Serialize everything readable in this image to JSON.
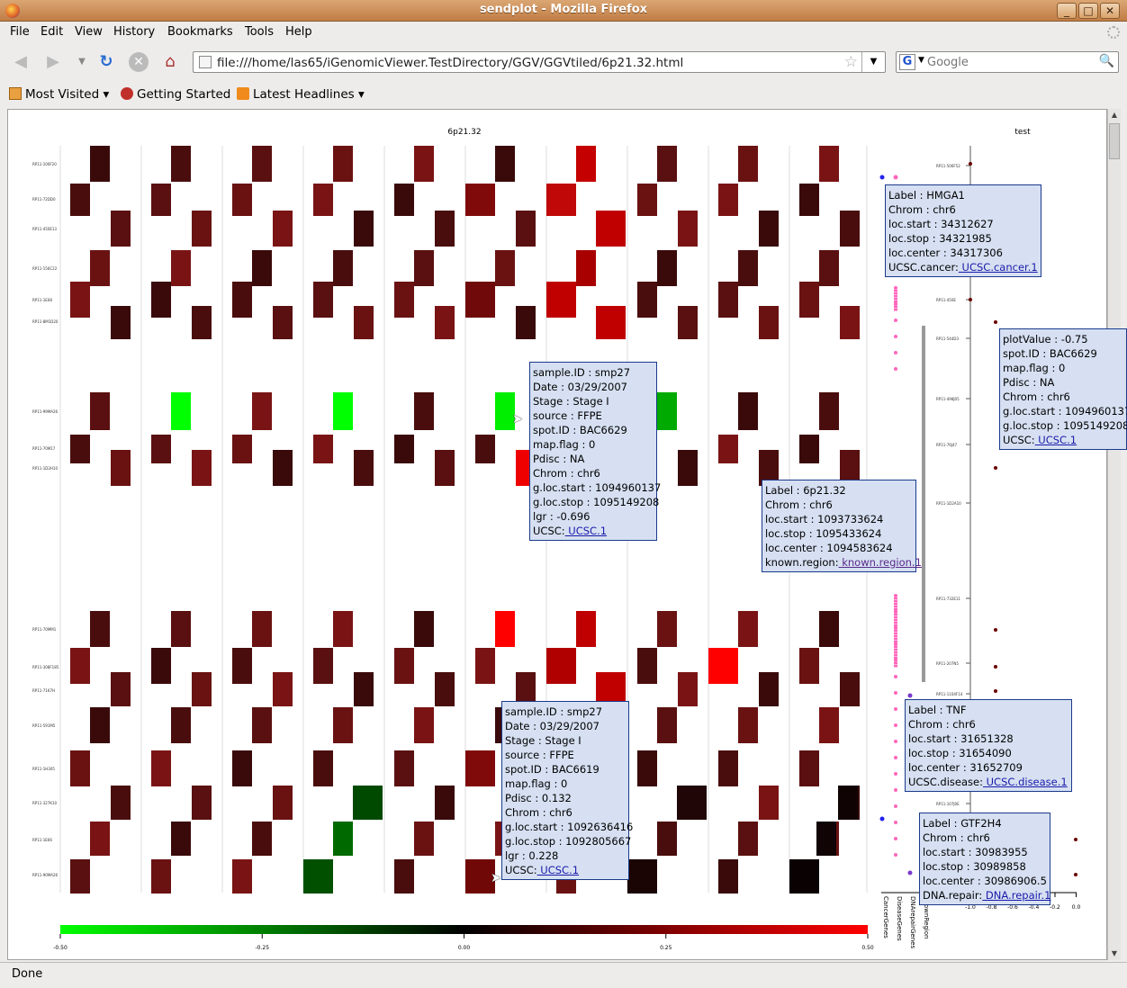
{
  "window": {
    "title": "sendplot - Mozilla Firefox",
    "buttons": [
      "_",
      "□",
      "✕"
    ]
  },
  "menu": [
    "File",
    "Edit",
    "View",
    "History",
    "Bookmarks",
    "Tools",
    "Help"
  ],
  "nav": {
    "url": "file:///home/las65/iGenomicViewer.TestDirectory/GGV/GGVtiled/6p21.32.html",
    "search_placeholder": "Google"
  },
  "bookmarks": [
    "Most Visited",
    "Getting Started",
    "Latest Headlines"
  ],
  "status": "Done",
  "colors": {
    "low": "#00ff00",
    "mid": "#000000",
    "high": "#ff0000",
    "tip_bg": "#d6e0f2",
    "tip_border": "#1a3a8c",
    "pink_dots": "#ff66bb"
  },
  "plot": {
    "title_main": "6p21.32",
    "title_right": "test",
    "colorbar_ticks": [
      "-0.50",
      "-0.25",
      "0.00",
      "0.25",
      "0.50"
    ],
    "right_axis_ticks": [
      "-1.0",
      "-0.8",
      "-0.6",
      "-0.4",
      "-0.2",
      "0.0"
    ],
    "track_labels": [
      "CancerGenes",
      "DiseaseGenes",
      "DNArepairGenes",
      "KnownRegion"
    ],
    "left_row_labels": [
      "RP11-100F20",
      "RP11-72DD0",
      "RP11-450E13",
      "RP11-156C22",
      "RP11-1E08",
      "RP11-8M1D20",
      "RP11-99MA26",
      "RP11-70M17",
      "RP11-1D2H10",
      "RP11-70MM1",
      "RP11-308F185",
      "RP11-71K7H",
      "RP11-591M5",
      "RP11-1H305",
      "RP11-327K10",
      "RP11-1E66",
      "RP11-90MA26"
    ],
    "right_row_labels": [
      "RP11-506F52",
      "RP11-450E",
      "RP11-544D3",
      "RP11-498J05",
      "RP11-76J47",
      "RP11-1D2A10",
      "RP11-732E11",
      "RP11-207N5",
      "RP11-1104F14",
      "RP11-107J0E"
    ]
  },
  "tooltips": [
    {
      "id": "tip-hmga1",
      "rows": [
        [
          "Label",
          "HMGA1"
        ],
        [
          "Chrom",
          "chr6"
        ],
        [
          "loc.start",
          "34312627"
        ],
        [
          "loc.stop",
          "34321985"
        ],
        [
          "loc.center",
          "34317306"
        ]
      ],
      "link": [
        "UCSC.cancer",
        "UCSC.cancer.1"
      ]
    },
    {
      "id": "tip-bac6629-right",
      "rows": [
        [
          "plotValue",
          "-0.75"
        ],
        [
          "spot.ID",
          "BAC6629"
        ],
        [
          "map.flag",
          "0"
        ],
        [
          "Pdisc",
          "NA"
        ],
        [
          "Chrom",
          "chr6"
        ],
        [
          "g.loc.start",
          "1094960137"
        ],
        [
          "g.loc.stop",
          "1095149208"
        ]
      ],
      "link": [
        "UCSC",
        "UCSC.1"
      ]
    },
    {
      "id": "tip-smp27-upper",
      "rows": [
        [
          "sample.ID",
          "smp27"
        ],
        [
          "Date",
          "03/29/2007"
        ],
        [
          "Stage",
          "Stage I"
        ],
        [
          "source",
          "FFPE"
        ],
        [
          "spot.ID",
          "BAC6629"
        ],
        [
          "map.flag",
          "0"
        ],
        [
          "Pdisc",
          "NA"
        ],
        [
          "Chrom",
          "chr6"
        ],
        [
          "g.loc.start",
          "1094960137"
        ],
        [
          "g.loc.stop",
          "1095149208"
        ],
        [
          "lgr",
          "-0.696"
        ]
      ],
      "link": [
        "UCSC",
        "UCSC.1"
      ]
    },
    {
      "id": "tip-6p21",
      "rows": [
        [
          "Label",
          "6p21.32"
        ],
        [
          "Chrom",
          "chr6"
        ],
        [
          "loc.start",
          "1093733624"
        ],
        [
          "loc.stop",
          "1095433624"
        ],
        [
          "loc.center",
          "1094583624"
        ]
      ],
      "link": [
        "known.region",
        "known.region.1"
      ]
    },
    {
      "id": "tip-tnf",
      "rows": [
        [
          "Label",
          "TNF"
        ],
        [
          "Chrom",
          "chr6"
        ],
        [
          "loc.start",
          "31651328"
        ],
        [
          "loc.stop",
          "31654090"
        ],
        [
          "loc.center",
          "31652709"
        ]
      ],
      "link": [
        "UCSC.disease",
        "UCSC.disease.1"
      ]
    },
    {
      "id": "tip-smp27-lower",
      "rows": [
        [
          "sample.ID",
          "smp27"
        ],
        [
          "Date",
          "03/29/2007"
        ],
        [
          "Stage",
          "Stage I"
        ],
        [
          "source",
          "FFPE"
        ],
        [
          "spot.ID",
          "BAC6619"
        ],
        [
          "map.flag",
          "0"
        ],
        [
          "Pdisc",
          "0.132"
        ],
        [
          "Chrom",
          "chr6"
        ],
        [
          "g.loc.start",
          "1092636416"
        ],
        [
          "g.loc.stop",
          "1092805667"
        ],
        [
          "lgr",
          "0.228"
        ]
      ],
      "link": [
        "UCSC",
        "UCSC.1"
      ]
    },
    {
      "id": "tip-gtf2h4",
      "rows": [
        [
          "Label",
          "GTF2H4"
        ],
        [
          "Chrom",
          "chr6"
        ],
        [
          "loc.start",
          "30983955"
        ],
        [
          "loc.stop",
          "30989858"
        ],
        [
          "loc.center",
          "30986906.5"
        ]
      ],
      "link": [
        "DNA.repair",
        "DNA.repair.1"
      ]
    }
  ]
}
